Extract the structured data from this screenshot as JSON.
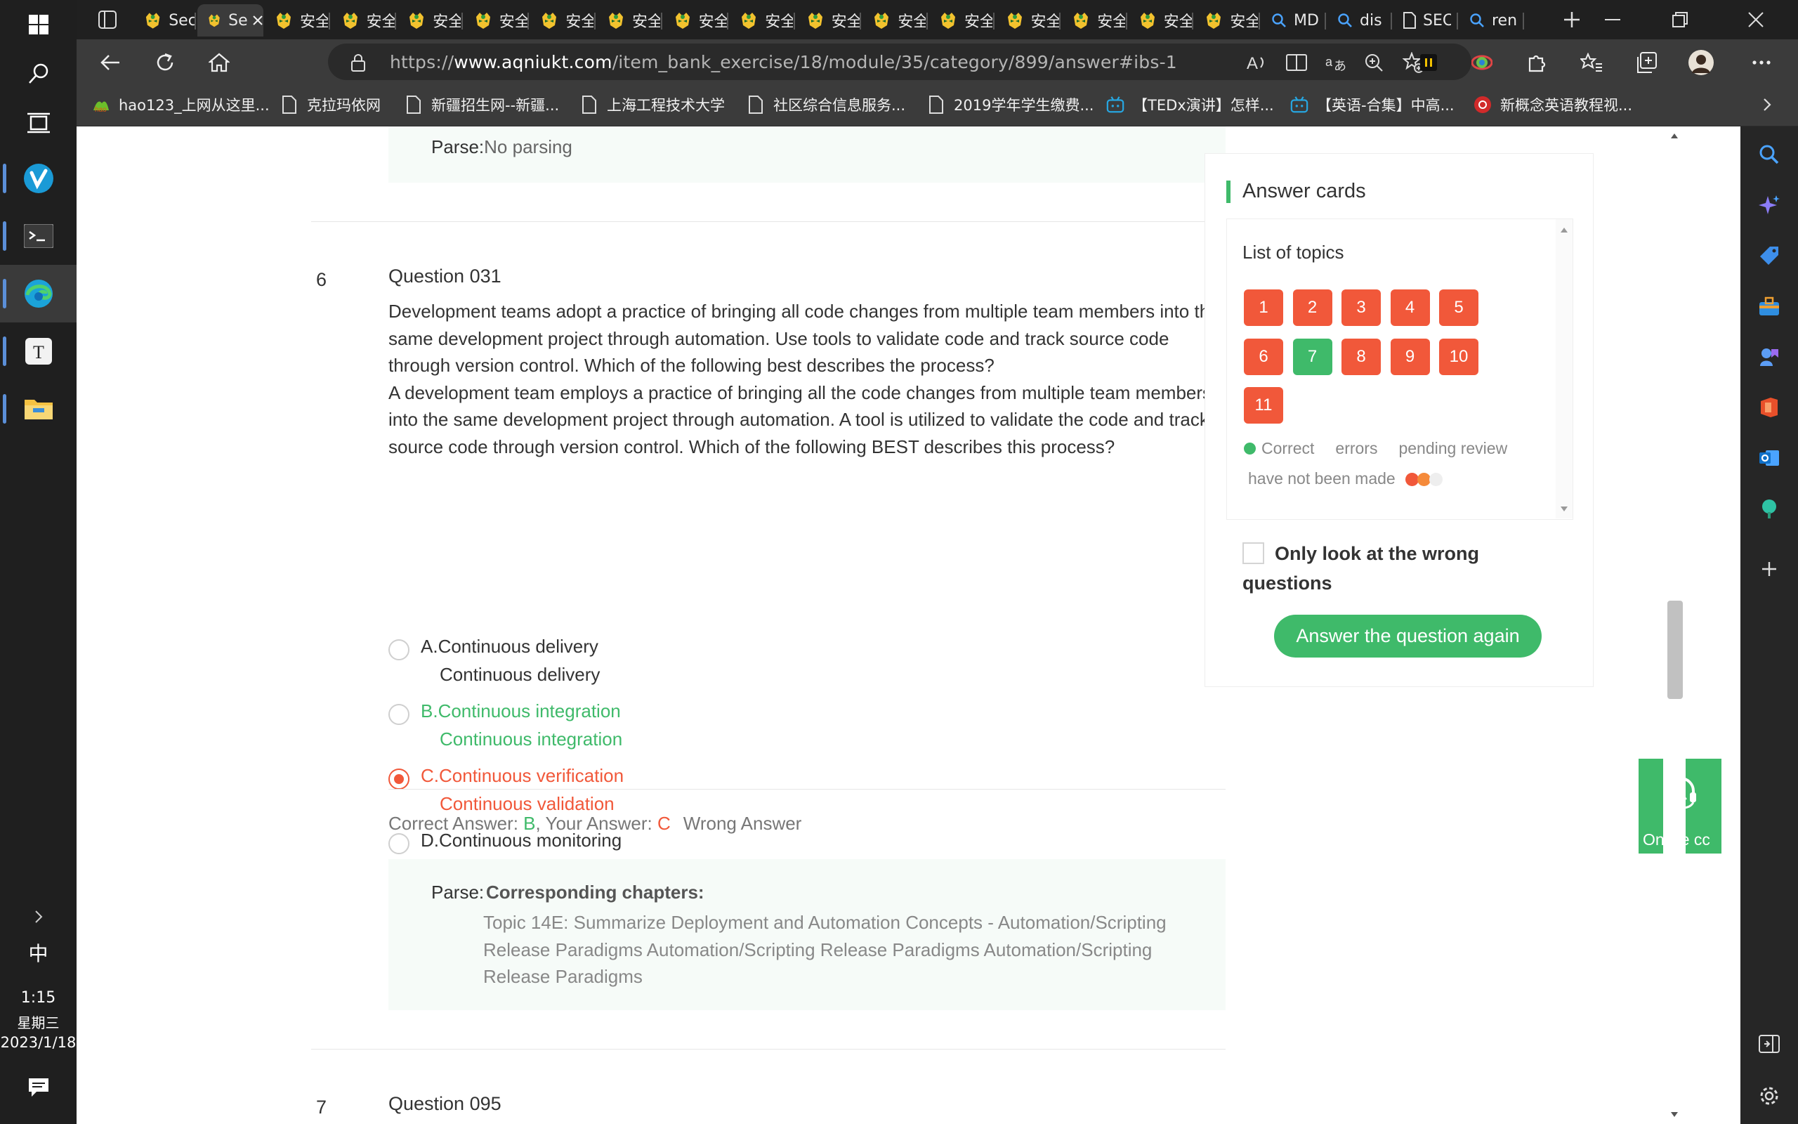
{
  "browser": {
    "tabs": [
      {
        "label": "Sec",
        "active": false
      },
      {
        "label": "Sec",
        "active": true
      },
      {
        "label": "安全",
        "active": false
      },
      {
        "label": "安全",
        "active": false
      },
      {
        "label": "安全",
        "active": false
      },
      {
        "label": "安全",
        "active": false
      },
      {
        "label": "安全",
        "active": false
      },
      {
        "label": "安全",
        "active": false
      },
      {
        "label": "安全",
        "active": false
      },
      {
        "label": "安全",
        "active": false
      },
      {
        "label": "安全",
        "active": false
      },
      {
        "label": "安全",
        "active": false
      },
      {
        "label": "安全",
        "active": false
      },
      {
        "label": "安全",
        "active": false
      },
      {
        "label": "安全",
        "active": false
      },
      {
        "label": "安全",
        "active": false
      },
      {
        "label": "安全",
        "active": false
      },
      {
        "label": "MD",
        "active": false
      },
      {
        "label": "dis",
        "active": false
      },
      {
        "label": "SEC",
        "active": false
      },
      {
        "label": "ren",
        "active": false
      }
    ],
    "url_prefix": "https://",
    "url_domain": "www.aqniukt.com",
    "url_path": "/item_bank_exercise/18/module/35/category/899/answer#ibs-1",
    "bookmarks": [
      "hao123_上网从这里...",
      "克拉玛依网",
      "新疆招生网--新疆...",
      "上海工程技术大学",
      "社区综合信息服务...",
      "2019学年学生缴费...",
      "【TEDx演讲】怎样...",
      "【英语-合集】中高...",
      "新概念英语教程视..."
    ]
  },
  "taskbar": {
    "ime": "中",
    "time": "1:15",
    "weekday": "星期三",
    "date": "2023/1/18"
  },
  "prev_question": {
    "parse_label": "Parse:",
    "parse_text": "No parsing"
  },
  "question": {
    "number": "6",
    "title": "Question 031",
    "text_1": "Development teams adopt a practice of bringing all code changes from multiple team members into the same development project through automation. Use tools to validate code and track source code through version control. Which of the following best describes the process?",
    "text_2": "A development team employs a practice of bringing all the code changes from multiple team members into the same development project through automation. A tool is utilized to validate the code and track source code through version control. Which of the following BEST describes this process?",
    "options": [
      {
        "label": "A.Continuous delivery",
        "sub": "Continuous delivery",
        "state": "normal"
      },
      {
        "label": "B.Continuous integration",
        "sub": "Continuous integration",
        "state": "correct"
      },
      {
        "label": "C.Continuous verification",
        "sub": "Continuous validation",
        "state": "selected-wrong"
      },
      {
        "label": "D.Continuous monitoring",
        "sub": "Continuous monitoring",
        "state": "normal"
      }
    ],
    "correct_answer_label": "Correct Answer: ",
    "correct_answer": "B",
    "your_answer_label": ", Your Answer: ",
    "your_answer": "C",
    "result": "Wrong Answer",
    "parse_label": "Parse:",
    "parse_heading": "Corresponding chapters:",
    "parse_body": "Topic 14E: Summarize Deployment and Automation Concepts - Automation/Scripting Release Paradigms Automation/Scripting Release Paradigms Automation/Scripting Release Paradigms"
  },
  "next_question": {
    "number": "7",
    "title": "Question 095"
  },
  "answer_card": {
    "title": "Answer cards",
    "list_title": "List of topics",
    "topics": [
      {
        "n": "1",
        "status": "wrong"
      },
      {
        "n": "2",
        "status": "wrong"
      },
      {
        "n": "3",
        "status": "wrong"
      },
      {
        "n": "4",
        "status": "wrong"
      },
      {
        "n": "5",
        "status": "wrong"
      },
      {
        "n": "6",
        "status": "wrong"
      },
      {
        "n": "7",
        "status": "correct"
      },
      {
        "n": "8",
        "status": "wrong"
      },
      {
        "n": "9",
        "status": "wrong"
      },
      {
        "n": "10",
        "status": "wrong"
      },
      {
        "n": "11",
        "status": "wrong"
      }
    ],
    "legend_correct": "Correct",
    "legend_errors": "errors",
    "legend_pending": "pending review",
    "legend_not_made": "have not been made",
    "only_wrong_label": "Only look at the wrong questions",
    "again_button": "Answer the question again"
  },
  "online_service": "Online cc",
  "colors": {
    "green": "#3fba6a",
    "orange": "#f1583a",
    "parse_bg": "#f6fbf8"
  }
}
